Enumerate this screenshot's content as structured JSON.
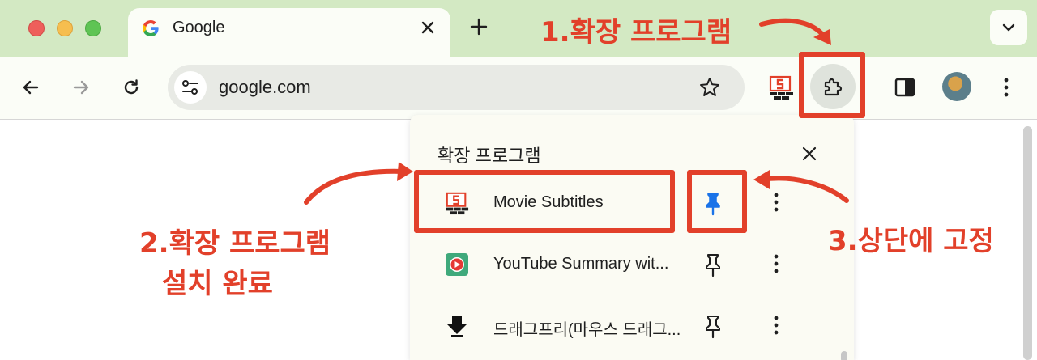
{
  "window": {
    "tab": {
      "title": "Google",
      "favicon": "google-g-icon"
    },
    "new_tab_icon": "plus-icon",
    "tab_search_icon": "chevron-down-icon"
  },
  "toolbar": {
    "back_icon": "arrow-left-icon",
    "forward_icon": "arrow-right-icon",
    "reload_icon": "reload-icon",
    "address": "google.com",
    "site_info_icon": "tune-icon",
    "bookmark_icon": "star-icon",
    "pinned_extension_icon": "movie-subtitles-icon",
    "extensions_icon": "puzzle-icon",
    "side_panel_icon": "side-panel-icon",
    "profile_icon": "avatar",
    "menu_icon": "kebab-menu-icon"
  },
  "extensions_popup": {
    "title": "확장 프로그램",
    "close_icon": "close-icon",
    "items": [
      {
        "name": "Movie Subtitles",
        "icon": "movie-subtitles-icon",
        "pinned": true
      },
      {
        "name": "YouTube Summary wit...",
        "icon": "youtube-summary-icon",
        "pinned": false
      },
      {
        "name": "드래그프리(마우스 드래그...",
        "icon": "dragfree-icon",
        "pinned": false
      }
    ]
  },
  "annotations": {
    "step1": "1.확장 프로그램",
    "step2_line1": "2.확장 프로그램",
    "step2_line2": "설치 완료",
    "step3": "3.상단에 고정"
  },
  "colors": {
    "annotation": "#e2402a",
    "tab_strip": "#d3e9c3",
    "pin_active": "#1a73e8"
  }
}
